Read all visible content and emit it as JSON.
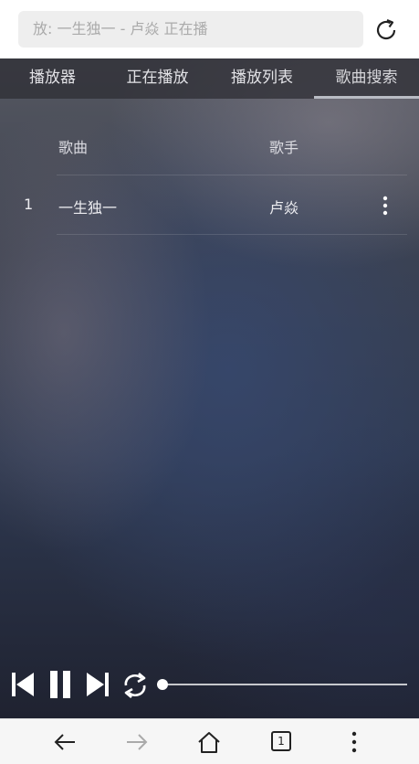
{
  "browser": {
    "url_text": "放: 一生独一 - 卢焱 正在播",
    "tab_count": "1"
  },
  "tabs": [
    {
      "label": "播放器"
    },
    {
      "label": "正在播放"
    },
    {
      "label": "播放列表"
    },
    {
      "label": "歌曲搜索",
      "active": true
    }
  ],
  "table": {
    "headers": {
      "song": "歌曲",
      "artist": "歌手"
    },
    "rows": [
      {
        "index": "1",
        "song": "一生独一",
        "artist": "卢焱"
      }
    ]
  },
  "player": {
    "progress": 0.0
  },
  "colors": {
    "tab_bar": "#2d2d34",
    "accent_underline": "#b9bcc4",
    "text_light": "#ececf0"
  }
}
